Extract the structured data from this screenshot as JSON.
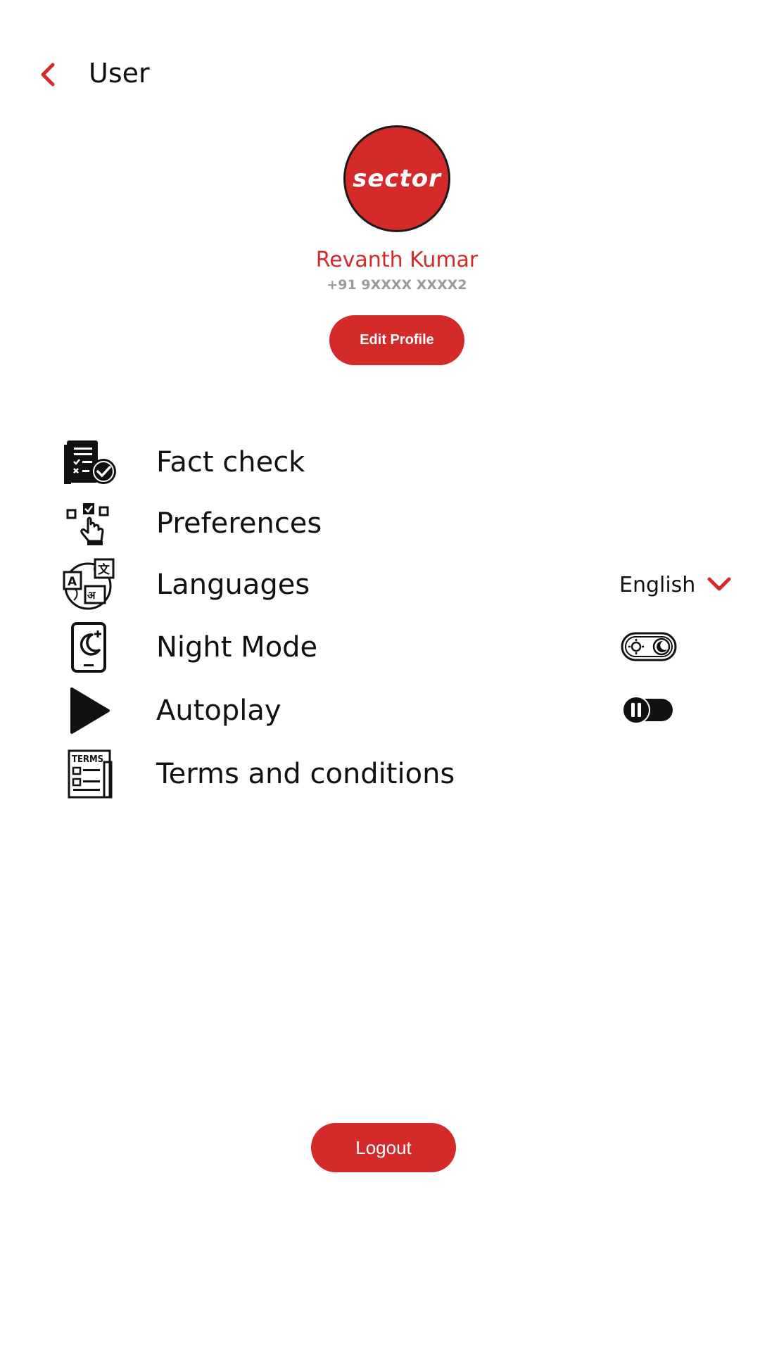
{
  "header": {
    "title": "User",
    "back_icon": "chevron-left-icon"
  },
  "profile": {
    "avatar_logo_text": "sector",
    "name": "Revanth Kumar",
    "phone": "+91 9XXXX XXXX2",
    "edit_label": "Edit Profile"
  },
  "menu": {
    "fact_check": {
      "label": "Fact check",
      "icon": "fact-check-icon"
    },
    "preferences": {
      "label": "Preferences",
      "icon": "preferences-icon"
    },
    "languages": {
      "label": "Languages",
      "icon": "languages-icon",
      "selected": "English"
    },
    "night_mode": {
      "label": "Night Mode",
      "icon": "night-mode-icon",
      "toggle_icon": "day-night-toggle-icon"
    },
    "autoplay": {
      "label": "Autoplay",
      "icon": "play-icon",
      "toggle_icon": "pause-toggle-icon"
    },
    "terms": {
      "label": "Terms and conditions",
      "icon": "terms-icon",
      "icon_text": "TERMS"
    }
  },
  "logout_label": "Logout",
  "colors": {
    "accent": "#d42a2a",
    "text": "#111111",
    "muted": "#9a9a9a",
    "background": "#ffffff"
  }
}
